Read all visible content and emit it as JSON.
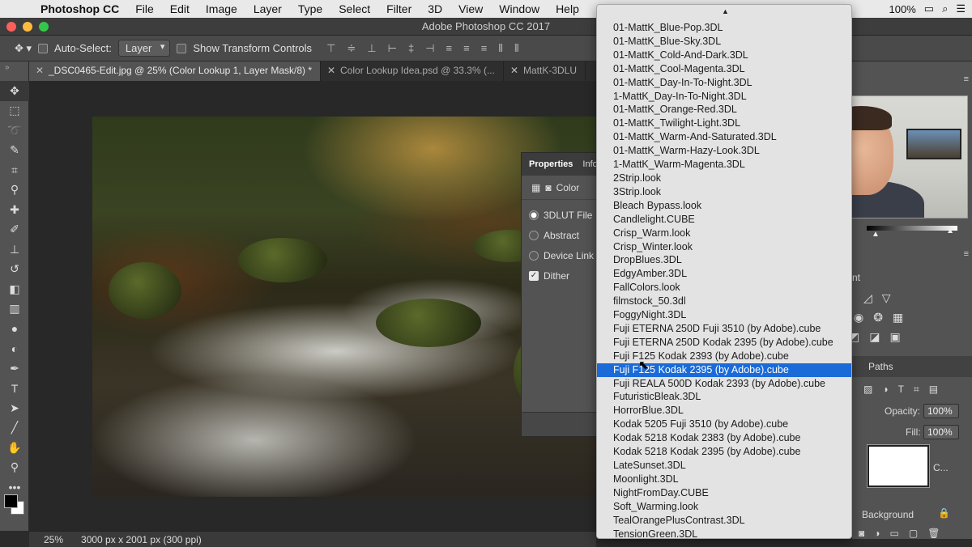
{
  "menubar": {
    "app_name": "Photoshop CC",
    "items": [
      "File",
      "Edit",
      "Image",
      "Layer",
      "Type",
      "Select",
      "Filter",
      "3D",
      "View",
      "Window",
      "Help"
    ],
    "battery": "100%"
  },
  "window": {
    "title": "Adobe Photoshop CC 2017"
  },
  "options": {
    "auto_select_label": "Auto-Select:",
    "auto_select_value": "Layer",
    "transform_label": "Show Transform Controls"
  },
  "tabs": [
    {
      "label": "_DSC0465-Edit.jpg @ 25% (Color Lookup 1, Layer Mask/8) *",
      "active": true
    },
    {
      "label": "Color Lookup Idea.psd @ 33.3% (...",
      "active": false
    },
    {
      "label": "MattK-3DLU",
      "active": false
    }
  ],
  "properties": {
    "tab_properties": "Properties",
    "tab_info": "Info",
    "adjustment_label": "Color",
    "options": [
      "3DLUT File",
      "Abstract",
      "Device Link"
    ],
    "dither_label": "Dither"
  },
  "lut_list": {
    "items": [
      "01-MattK_Blue-Pop.3DL",
      "01-MattK_Blue-Sky.3DL",
      "01-MattK_Cold-And-Dark.3DL",
      "01-MattK_Cool-Magenta.3DL",
      "01-MattK_Day-In-To-Night.3DL",
      "1-MattK_Day-In-To-Night.3DL",
      "01-MattK_Orange-Red.3DL",
      "01-MattK_Twilight-Light.3DL",
      "01-MattK_Warm-And-Saturated.3DL",
      "01-MattK_Warm-Hazy-Look.3DL",
      "1-MattK_Warm-Magenta.3DL",
      "2Strip.look",
      "3Strip.look",
      "Bleach Bypass.look",
      "Candlelight.CUBE",
      "Crisp_Warm.look",
      "Crisp_Winter.look",
      "DropBlues.3DL",
      "EdgyAmber.3DL",
      "FallColors.look",
      "filmstock_50.3dl",
      "FoggyNight.3DL",
      "Fuji ETERNA 250D Fuji 3510 (by Adobe).cube",
      "Fuji ETERNA 250D Kodak 2395 (by Adobe).cube",
      "Fuji F125 Kodak 2393 (by Adobe).cube",
      "Fuji F125 Kodak 2395 (by Adobe).cube",
      "Fuji REALA 500D Kodak 2393 (by Adobe).cube",
      "FuturisticBleak.3DL",
      "HorrorBlue.3DL",
      "Kodak 5205 Fuji 3510 (by Adobe).cube",
      "Kodak 5218 Kodak 2383 (by Adobe).cube",
      "Kodak 5218 Kodak 2395 (by Adobe).cube",
      "LateSunset.3DL",
      "Moonlight.3DL",
      "NightFromDay.CUBE",
      "Soft_Warming.look",
      "TealOrangePlusContrast.3DL",
      "TensionGreen.3DL"
    ],
    "selected_index": 25
  },
  "layers_panel": {
    "paths_tab": "Paths",
    "opacity_label": "Opacity:",
    "opacity_value": "100%",
    "fill_label": "Fill:",
    "fill_value": "100%",
    "layer_name_short": "C...",
    "background_label": "Background",
    "adjustments_partial": "nt"
  },
  "status": {
    "zoom": "25%",
    "doc_info": "3000 px x 2001 px (300 ppi)"
  },
  "colors": {
    "selection": "#1a6bd8",
    "panel": "#535353"
  }
}
